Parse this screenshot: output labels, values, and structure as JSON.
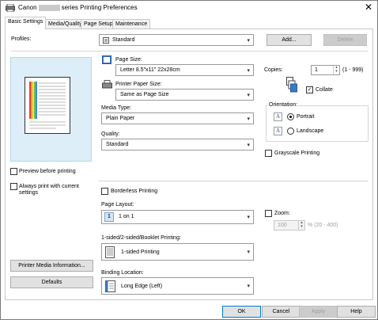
{
  "window": {
    "title_prefix": "Canon",
    "title_suffix": "series Printing Preferences",
    "close_glyph": "✕"
  },
  "tabs": [
    {
      "label": "Basic Settings"
    },
    {
      "label": "Media/Quality"
    },
    {
      "label": "Page Setup"
    },
    {
      "label": "Maintenance"
    }
  ],
  "profiles": {
    "label": "Profiles:",
    "value": "Standard",
    "add_label": "Add...",
    "delete_label": "Delete"
  },
  "page_size": {
    "label": "Page Size:",
    "value": "Letter 8.5\"x11\" 22x28cm"
  },
  "printer_paper_size": {
    "label": "Printer Paper Size:",
    "value": "Same as Page Size"
  },
  "media_type": {
    "label": "Media Type:",
    "value": "Plain Paper"
  },
  "quality": {
    "label": "Quality:",
    "value": "Standard"
  },
  "copies": {
    "label": "Copies:",
    "value": "1",
    "range": "(1 - 999)",
    "collate_label": "Collate",
    "collate_checked": true
  },
  "orientation": {
    "label": "Orientation:",
    "portrait_label": "Portrait",
    "landscape_label": "Landscape",
    "selected": "Portrait"
  },
  "grayscale": {
    "label": "Grayscale Printing",
    "checked": false
  },
  "preview": {
    "label": "Preview before printing",
    "checked": false
  },
  "always_print": {
    "label_line1": "Always print with current",
    "label_line2": "settings",
    "checked": false
  },
  "borderless": {
    "label": "Borderless Printing",
    "checked": false
  },
  "page_layout": {
    "label": "Page Layout:",
    "value": "1 on 1"
  },
  "zoom": {
    "label": "Zoom:",
    "value": "100",
    "range": "% (20 - 400)",
    "checked": false
  },
  "duplex": {
    "label": "1-sided/2-sided/Booklet Printing:",
    "value": "1-sided Printing"
  },
  "binding": {
    "label": "Binding Location:",
    "value": "Long Edge (Left)"
  },
  "left_buttons": {
    "media_info": "Printer Media Information...",
    "defaults": "Defaults"
  },
  "footer": {
    "ok": "OK",
    "cancel": "Cancel",
    "apply": "Apply",
    "help": "Help"
  },
  "icons": {
    "dropdown": "▾",
    "spin_up": "▴",
    "spin_down": "▾",
    "check": "✓"
  },
  "colors": {
    "accent_border": "#0078d7",
    "disabled_text": "#a0a0a0"
  }
}
